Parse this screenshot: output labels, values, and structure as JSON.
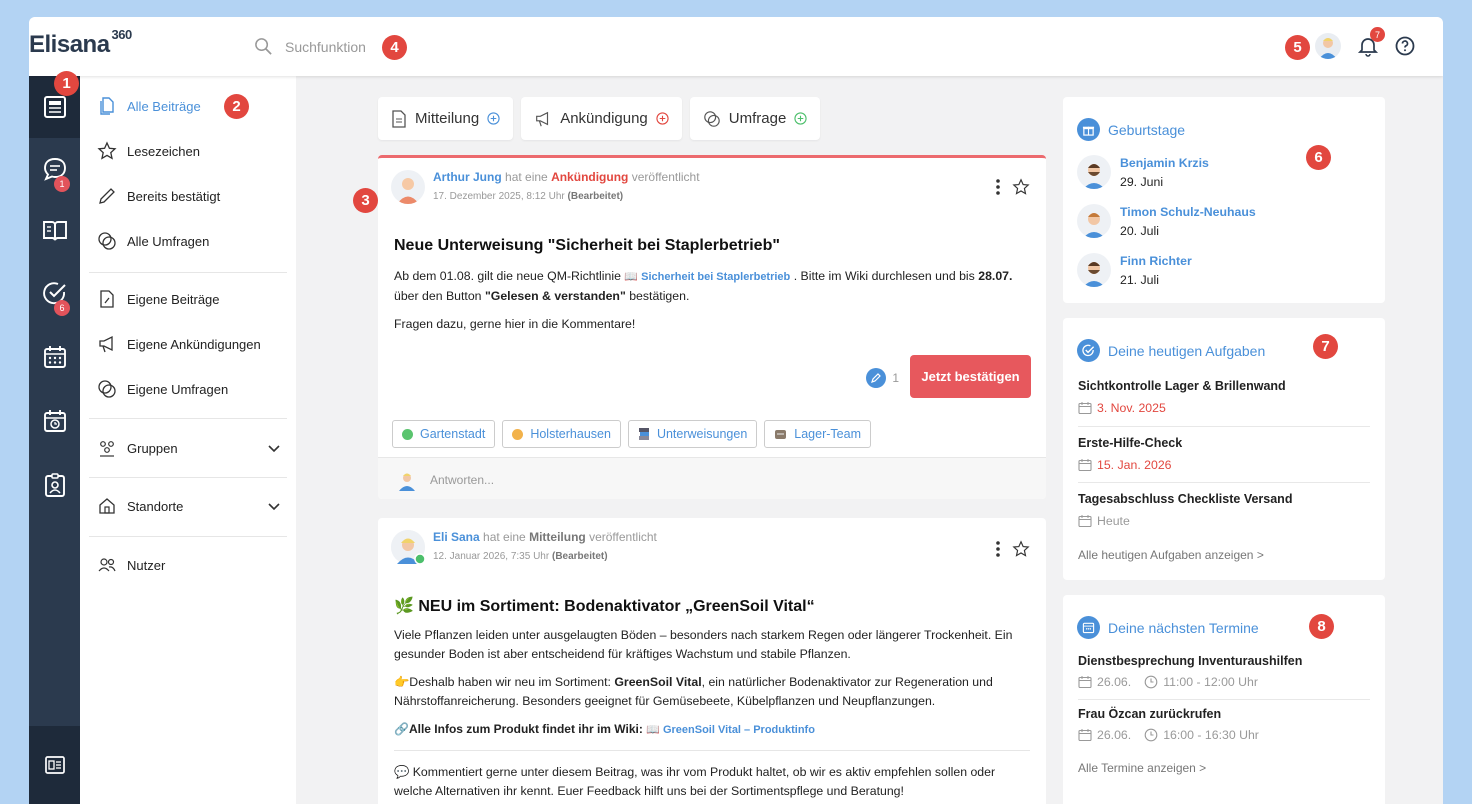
{
  "app": {
    "logo": "Elisana",
    "logo_sup": "360"
  },
  "search": {
    "placeholder": "Suchfunktion"
  },
  "markers": [
    "1",
    "2",
    "3",
    "4",
    "5",
    "6",
    "7",
    "8"
  ],
  "notifications": {
    "count": "7"
  },
  "rail": {
    "chat_badge": "1",
    "tasks_badge": "6"
  },
  "subnav": {
    "all_posts": "Alle Beiträge",
    "bookmarks": "Lesezeichen",
    "confirmed": "Bereits bestätigt",
    "all_polls": "Alle Umfragen",
    "own_posts": "Eigene Beiträge",
    "own_announcements": "Eigene Ankündigungen",
    "own_polls": "Eigene Umfragen",
    "groups": "Gruppen",
    "locations": "Standorte",
    "users": "Nutzer"
  },
  "post_buttons": {
    "message": "Mitteilung",
    "announcement": "Ankündigung",
    "poll": "Umfrage"
  },
  "post1": {
    "author": "Arthur Jung",
    "pre": "hat eine",
    "type": "Ankündigung",
    "post": "veröffentlicht",
    "date": "17. Dezember 2025, 8:12 Uhr",
    "edited": "(Bearbeitet)",
    "title": "Neue Unterweisung \"Sicherheit bei Staplerbetrieb\"",
    "p1a": "Ab dem 01.08. gilt die neue QM-Richtlinie ",
    "p1link": "📖 Sicherheit bei Staplerbetrieb",
    "p1b": " . Bitte im Wiki durchlesen und bis ",
    "p1date": "28.07.",
    "p1c": "über den Button ",
    "p1btn": "\"Gelesen & verstanden\"",
    "p1d": " bestätigen.",
    "p2": "Fragen dazu, gerne hier in die Kommentare!",
    "confirm_count": "1",
    "confirm_label": "Jetzt bestätigen",
    "tags": [
      "Gartenstadt",
      "Holsterhausen",
      "Unterweisungen",
      "Lager-Team"
    ],
    "reply_placeholder": "Antworten..."
  },
  "post2": {
    "author": "Eli Sana",
    "pre": "hat eine",
    "type": "Mitteilung",
    "post": "veröffentlicht",
    "date": "12. Januar 2026, 7:35 Uhr",
    "edited": "(Bearbeitet)",
    "title": "🌿 NEU im Sortiment: Bodenaktivator „GreenSoil Vital“",
    "p1": "Viele Pflanzen leiden unter ausgelaugten Böden – besonders nach starkem Regen oder längerer Trockenheit. Ein gesunder Boden ist aber entscheidend für kräftiges Wachstum und stabile Pflanzen.",
    "p2a": "👉Deshalb haben wir neu im Sortiment: ",
    "p2b": "GreenSoil Vital",
    "p2c": ", ein natürlicher Bodenaktivator zur Regeneration und Nährstoffanreicherung. Besonders geeignet für Gemüsebeete, Kübelpflanzen und Neupflanzungen.",
    "p3a": "🔗Alle Infos zum Produkt findet ihr im Wiki: ",
    "p3link": "📖 GreenSoil Vital – Produktinfo",
    "p4": "💬 Kommentiert gerne unter diesem Beitrag, was ihr vom Produkt haltet, ob wir es aktiv empfehlen sollen oder welche Alternativen ihr kennt. Euer Feedback hilft uns bei der Sortimentspflege und Beratung!"
  },
  "birthdays": {
    "title": "Geburtstage",
    "items": [
      {
        "name": "Benjamin Krzis",
        "date": "29. Juni"
      },
      {
        "name": "Timon Schulz-Neuhaus",
        "date": "20. Juli"
      },
      {
        "name": "Finn Richter",
        "date": "21. Juli"
      }
    ]
  },
  "tasks": {
    "title": "Deine heutigen Aufgaben",
    "items": [
      {
        "title": "Sichtkontrolle Lager & Brillenwand",
        "date": "3. Nov. 2025"
      },
      {
        "title": "Erste-Hilfe-Check",
        "date": "15. Jan. 2026"
      },
      {
        "title": "Tagesabschluss Checkliste Versand",
        "date": "Heute"
      }
    ],
    "link": "Alle heutigen Aufgaben anzeigen >"
  },
  "appointments": {
    "title": "Deine nächsten Termine",
    "items": [
      {
        "title": "Dienstbesprechung Inventuraushilfen",
        "date": "26.06.",
        "time": "11:00 - 12:00 Uhr"
      },
      {
        "title": "Frau Özcan zurückrufen",
        "date": "26.06.",
        "time": "16:00 - 16:30 Uhr"
      }
    ],
    "link": "Alle Termine anzeigen >"
  },
  "colors": {
    "accent": "#4a90d9",
    "rail": "#2b3a4e",
    "red": "#e2473f",
    "confirm": "#e7585d"
  }
}
